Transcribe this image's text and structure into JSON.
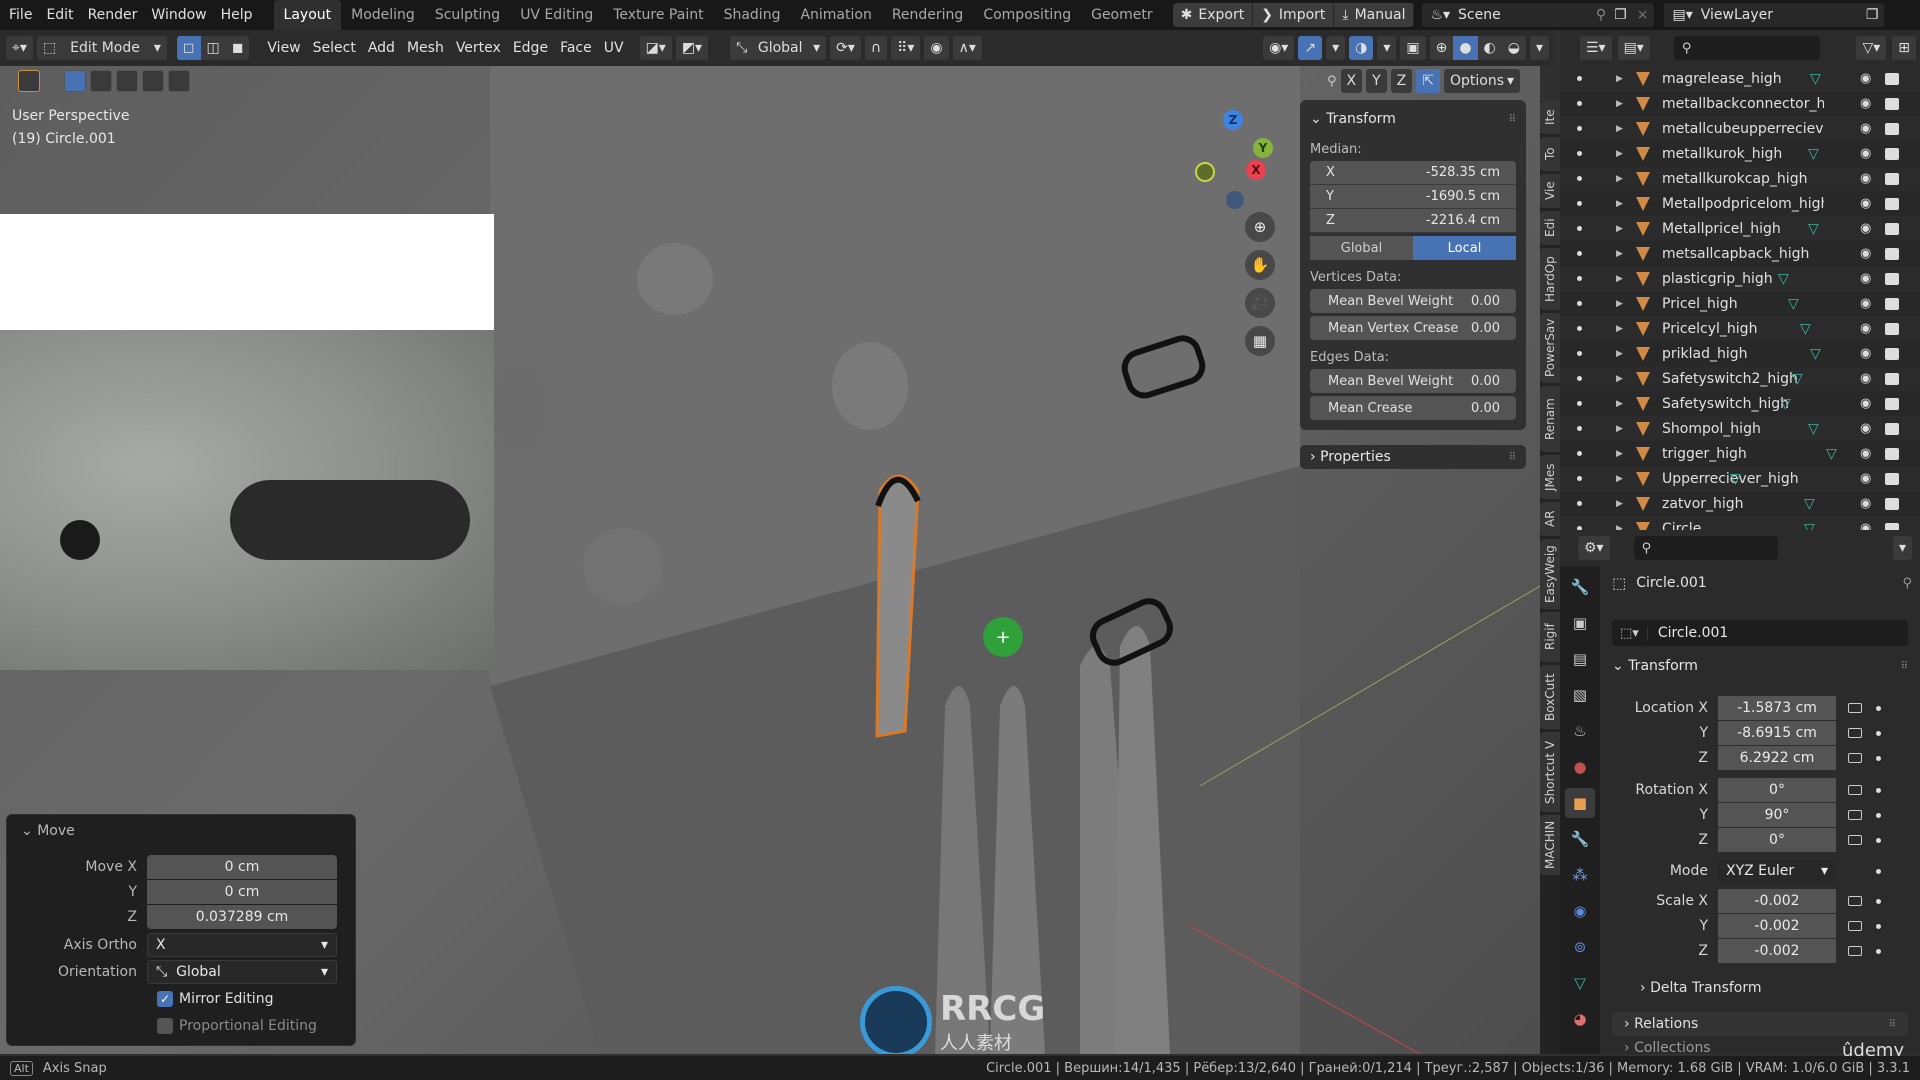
{
  "menu": [
    "File",
    "Edit",
    "Render",
    "Window",
    "Help"
  ],
  "workspaces": [
    "Layout",
    "Modeling",
    "Sculpting",
    "UV Editing",
    "Texture Paint",
    "Shading",
    "Animation",
    "Rendering",
    "Compositing",
    "Geometr"
  ],
  "active_workspace": "Layout",
  "topbar_buttons": {
    "export": "Export",
    "import": "Import",
    "manual": "Manual"
  },
  "scene": "Scene",
  "view_layer": "ViewLayer",
  "header": {
    "mode": "Edit Mode",
    "menus": [
      "View",
      "Select",
      "Add",
      "Mesh",
      "Vertex",
      "Edge",
      "Face",
      "UV"
    ],
    "orientation": "Global",
    "axes": [
      "X",
      "Y",
      "Z"
    ],
    "options": "Options"
  },
  "viewport": {
    "view_name": "User Perspective",
    "object_info": "(19) Circle.001",
    "gizmo_axes": {
      "z": "Z",
      "y": "Y",
      "x": "X"
    },
    "colors": {
      "x": "#e8414f",
      "y": "#86b43a",
      "z": "#3c84e0"
    }
  },
  "npanel": {
    "title": "Transform",
    "median_label": "Median:",
    "median": [
      {
        "axis": "X",
        "value": "-528.35 cm"
      },
      {
        "axis": "Y",
        "value": "-1690.5 cm"
      },
      {
        "axis": "Z",
        "value": "-2216.4 cm"
      }
    ],
    "space_options": [
      "Global",
      "Local"
    ],
    "space_active": "Local",
    "vertices_label": "Vertices Data:",
    "vertices": [
      {
        "label": "Mean Bevel Weight",
        "value": "0.00"
      },
      {
        "label": "Mean Vertex Crease",
        "value": "0.00"
      }
    ],
    "edges_label": "Edges Data:",
    "edges": [
      {
        "label": "Mean Bevel Weight",
        "value": "0.00"
      },
      {
        "label": "Mean Crease",
        "value": "0.00"
      }
    ],
    "properties_label": "Properties"
  },
  "vertical_tabs": [
    "Ite",
    "To",
    "Vie",
    "Edi",
    "HardOp",
    "PowerSav",
    "Renam",
    "JMes",
    "AR",
    "EasyWeig",
    "Rigif",
    "BoxCutt",
    "Shortcut V",
    "MACHIN"
  ],
  "outliner": {
    "items": [
      {
        "name": "magrelease_high",
        "mesh": true
      },
      {
        "name": "metallbackconnector_higl",
        "mesh": false
      },
      {
        "name": "metallcubeupperreciever",
        "mesh": false
      },
      {
        "name": "metallkurok_high",
        "mesh": true
      },
      {
        "name": "metallkurokcap_high",
        "mesh": false
      },
      {
        "name": "Metallpodpricelom_high",
        "mesh": false
      },
      {
        "name": "Metallpricel_high",
        "mesh": true
      },
      {
        "name": "metsallcapback_high",
        "mesh": false
      },
      {
        "name": "plasticgrip_high",
        "mesh": true
      },
      {
        "name": "Pricel_high",
        "mesh": true
      },
      {
        "name": "Pricelcyl_high",
        "mesh": true
      },
      {
        "name": "priklad_high",
        "mesh": true
      },
      {
        "name": "Safetyswitch2_high",
        "mesh": true
      },
      {
        "name": "Safetyswitch_high",
        "mesh": true
      },
      {
        "name": "Shompol_high",
        "mesh": true
      },
      {
        "name": "trigger_high",
        "mesh": true
      },
      {
        "name": "Upperreciever_high",
        "mesh": true
      },
      {
        "name": "zatvor_high",
        "mesh": true
      },
      {
        "name": "Circle",
        "mesh": true
      }
    ]
  },
  "properties": {
    "object_name": "Circle.001",
    "datablock_name": "Circle.001",
    "transform_title": "Transform",
    "location": {
      "label": "Location X",
      "x": "-1.5873 cm",
      "y": "-8.6915 cm",
      "z": "6.2922 cm"
    },
    "rotation": {
      "label": "Rotation X",
      "x": "0°",
      "y": "90°",
      "z": "0°"
    },
    "mode_label": "Mode",
    "mode": "XYZ Euler",
    "scale": {
      "label": "Scale X",
      "x": "-0.002",
      "y": "-0.002",
      "z": "-0.002"
    },
    "axis_y": "Y",
    "axis_z": "Z",
    "delta_transform": "Delta Transform",
    "relations": "Relations",
    "collections": "Collections"
  },
  "move_operator": {
    "title": "Move",
    "move_x_label": "Move X",
    "move_x": "0 cm",
    "y_label": "Y",
    "move_y": "0 cm",
    "z_label": "Z",
    "move_z": "0.037289 cm",
    "axis_ortho_label": "Axis Ortho",
    "axis_ortho": "X",
    "orientation_label": "Orientation",
    "orientation": "Global",
    "mirror_editing": {
      "label": "Mirror Editing",
      "checked": true
    },
    "proportional_editing": {
      "label": "Proportional Editing",
      "checked": false
    }
  },
  "status": {
    "key": "Alt",
    "hint": "Axis Snap",
    "stats": "Circle.001 | Вершин:14/1,435 | Рёбер:13/2,640 | Граней:0/1,214 | Треуг.:2,587 | Objects:1/36 | Memory: 1.68 GiB | VRAM: 1.0/6.0 GiB | 3.3.1"
  },
  "watermark": {
    "brand": "RRCG",
    "sub": "人人素材",
    "udemy": "ûdemy"
  }
}
